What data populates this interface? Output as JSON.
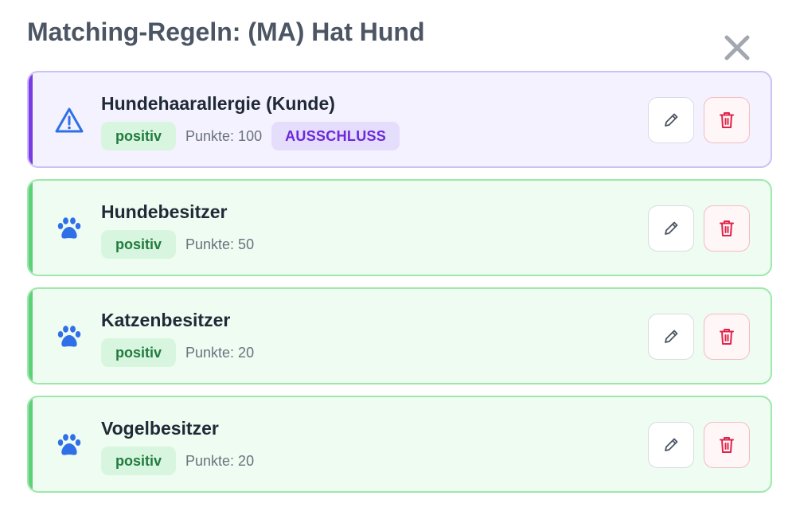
{
  "dialog": {
    "title": "Matching-Regeln: (MA) Hat Hund",
    "close_icon": "close-icon"
  },
  "colors": {
    "positive_accent": "#5fd07a",
    "exclusion_accent": "#7a3ae6",
    "icon_blue": "#2f6fe8",
    "delete_red": "#e0234a"
  },
  "rules": [
    {
      "name": "Hundehaarallergie (Kunde)",
      "icon": "warning-icon",
      "badge": "positiv",
      "points": "Punkte: 100",
      "exclusion": "AUSSCHLUSS"
    },
    {
      "name": "Hundebesitzer",
      "icon": "paw-icon",
      "badge": "positiv",
      "points": "Punkte: 50"
    },
    {
      "name": "Katzenbesitzer",
      "icon": "paw-icon",
      "badge": "positiv",
      "points": "Punkte: 20"
    },
    {
      "name": "Vogelbesitzer",
      "icon": "paw-icon",
      "badge": "positiv",
      "points": "Punkte: 20"
    }
  ]
}
